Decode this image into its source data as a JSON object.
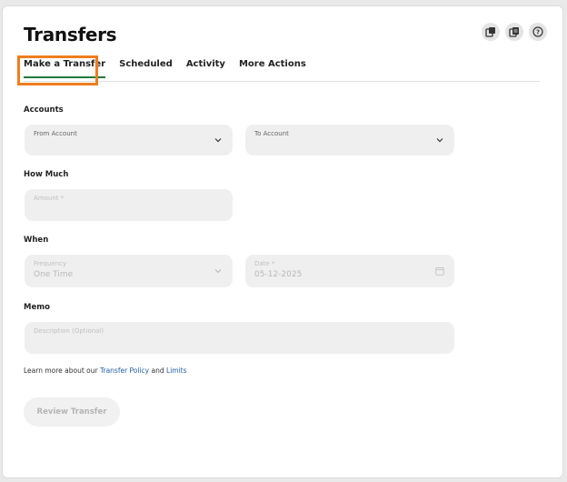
{
  "page": {
    "title": "Transfers"
  },
  "header_icons": [
    {
      "name": "accounts-icon"
    },
    {
      "name": "statements-icon"
    },
    {
      "name": "help-icon"
    }
  ],
  "tabs": [
    {
      "label": "Make a Transfer",
      "active": true
    },
    {
      "label": "Scheduled",
      "active": false
    },
    {
      "label": "Activity",
      "active": false
    },
    {
      "label": "More Actions",
      "active": false
    }
  ],
  "sections": {
    "accounts": "Accounts",
    "how_much": "How Much",
    "when": "When",
    "memo": "Memo"
  },
  "fields": {
    "from_account": {
      "label": "From Account",
      "value": ""
    },
    "to_account": {
      "label": "To Account",
      "value": ""
    },
    "amount": {
      "label": "Amount *",
      "value": ""
    },
    "frequency": {
      "label": "Frequency",
      "value": "One Time"
    },
    "date": {
      "label": "Date *",
      "value": "05-12-2025"
    },
    "description": {
      "label": "Description (Optional)",
      "value": ""
    }
  },
  "footer": {
    "learn_prefix": "Learn more about our",
    "transfer_policy": "Transfer Policy",
    "and": "and",
    "limits": "Limits"
  },
  "actions": {
    "review_label": "Review Transfer"
  },
  "colors": {
    "accent": "#1f7a3c",
    "highlight": "#f07d1e",
    "link": "#1e5fa8"
  }
}
